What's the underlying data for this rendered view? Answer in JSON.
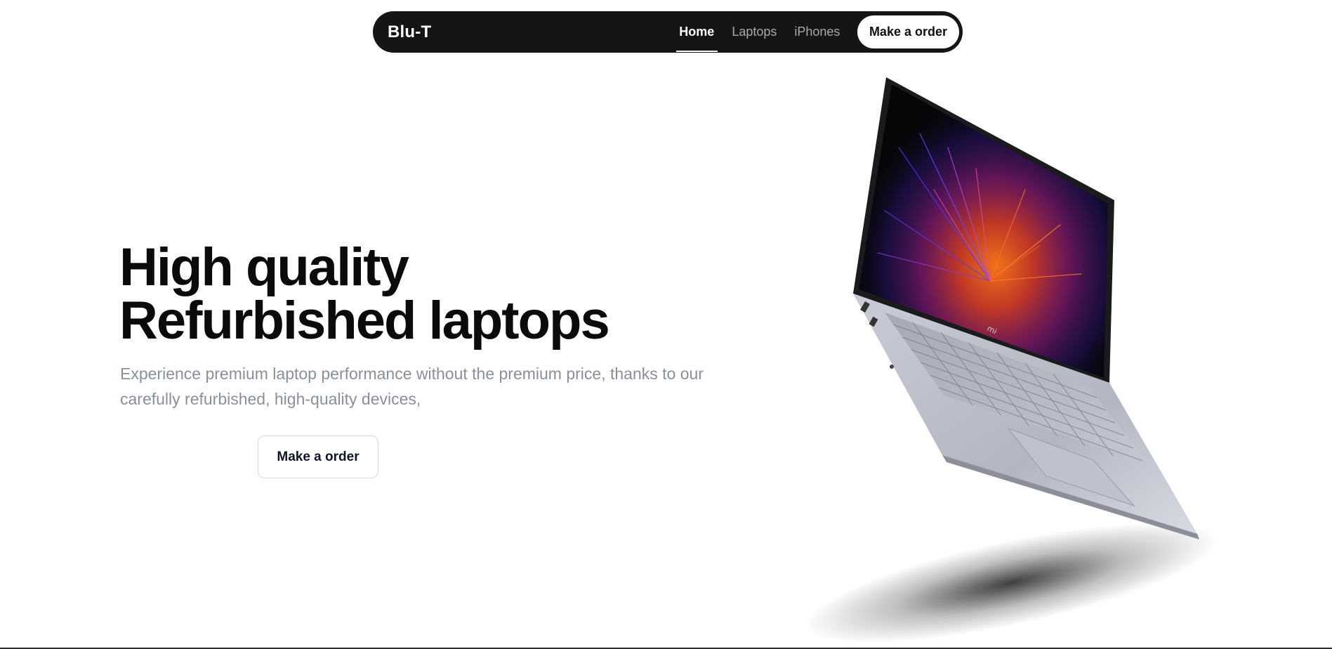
{
  "navbar": {
    "brand": "Blu-T",
    "links": [
      {
        "label": "Home",
        "active": true
      },
      {
        "label": "Laptops",
        "active": false
      },
      {
        "label": "iPhones",
        "active": false
      }
    ],
    "cta_label": "Make a order"
  },
  "hero": {
    "title_line1": "High quality",
    "title_line2": "Refurbished laptops",
    "description": "Experience premium laptop performance without the premium price, thanks to our carefully refurbished, high-quality devices,",
    "cta_label": "Make a order"
  },
  "laptop": {
    "logo_text": "mi"
  },
  "colors": {
    "navbar_bg": "#151515",
    "title": "#0b0b0b",
    "description": "#8a8f99"
  }
}
